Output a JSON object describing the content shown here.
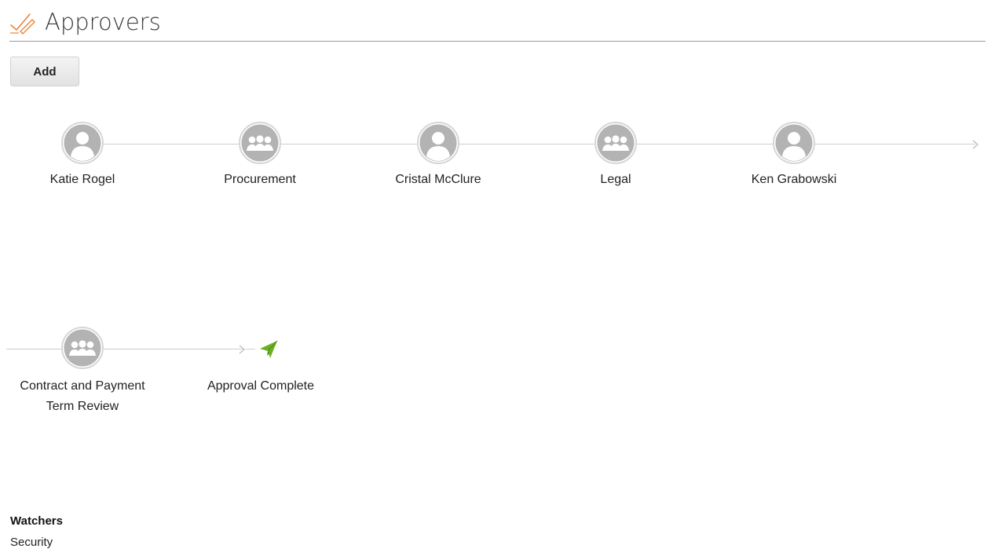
{
  "header": {
    "title": "Approvers",
    "icon": "approval-signature-icon",
    "accent_color": "#e8843a"
  },
  "toolbar": {
    "add_label": "Add"
  },
  "approval_flow": {
    "row1": [
      {
        "label": "Katie Rogel",
        "type": "person",
        "icon": "user-icon"
      },
      {
        "label": "Procurement",
        "type": "group",
        "icon": "group-icon"
      },
      {
        "label": "Cristal McClure",
        "type": "person",
        "icon": "user-icon"
      },
      {
        "label": "Legal",
        "type": "group",
        "icon": "group-icon"
      },
      {
        "label": "Ken Grabowski",
        "type": "person",
        "icon": "user-icon"
      }
    ],
    "row2": [
      {
        "label": "Contract and Payment Term Review",
        "type": "group",
        "icon": "group-icon"
      }
    ],
    "complete": {
      "label": "Approval Complete",
      "icon": "paper-plane-icon",
      "color": "#6ab023"
    }
  },
  "watchers": {
    "title": "Watchers",
    "value": "Security"
  }
}
